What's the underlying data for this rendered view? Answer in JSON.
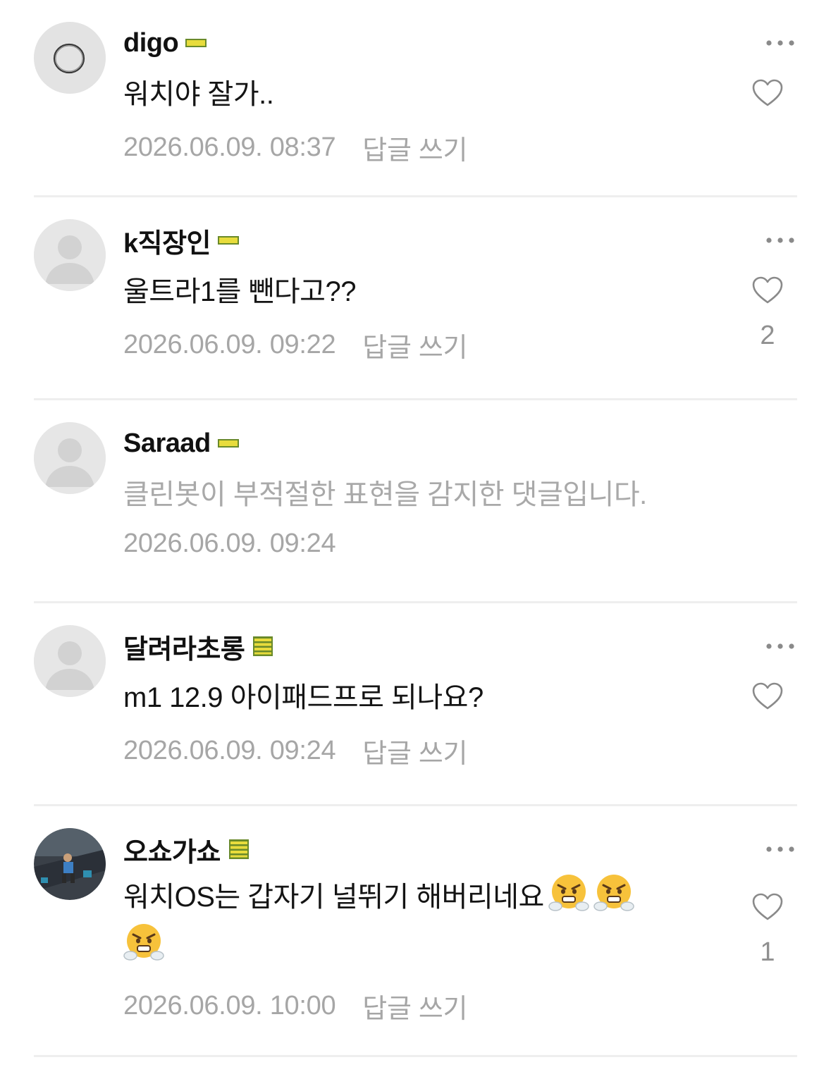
{
  "colors": {
    "text": "#111111",
    "meta": "#a6a6a6",
    "filtered": "#a9a9a9",
    "divider": "#eeeeee",
    "badge_yellow": "#e8dc3c",
    "badge_green": "#6a8a2a",
    "icon_gray": "#8a8a8a"
  },
  "comments": [
    {
      "nickname": "digo",
      "badge": "grade-1-icon",
      "avatar": "ring-avatar",
      "text": "워치야 잘가..",
      "time": "2026.06.09. 08:37",
      "reply": "답글 쓰기",
      "likes": ""
    },
    {
      "nickname": "k직장인",
      "badge": "grade-1-icon",
      "avatar": "default-avatar",
      "text": "울트라1를 뺀다고??",
      "time": "2026.06.09. 09:22",
      "reply": "답글 쓰기",
      "likes": "2"
    },
    {
      "nickname": "Saraad",
      "badge": "grade-1-icon",
      "avatar": "default-avatar",
      "text": "클린봇이 부적절한 표현을 감지한 댓글입니다.",
      "time": "2026.06.09. 09:24",
      "reply": "",
      "likes": ""
    },
    {
      "nickname": "달려라초롱",
      "badge": "grade-4-icon",
      "avatar": "default-avatar",
      "text": "m1 12.9 아이패드프로 되나요?",
      "time": "2026.06.09. 09:24",
      "reply": "답글 쓰기",
      "likes": ""
    },
    {
      "nickname": "오쇼가쇼",
      "badge": "grade-4-icon",
      "avatar": "photo-avatar",
      "text": "워치OS는 갑자기 널뛰기 해버리네요",
      "emojis": [
        "huffing-face-emoji",
        "huffing-face-emoji",
        "huffing-face-emoji"
      ],
      "time": "2026.06.09. 10:00",
      "reply": "답글 쓰기",
      "likes": "1"
    }
  ]
}
